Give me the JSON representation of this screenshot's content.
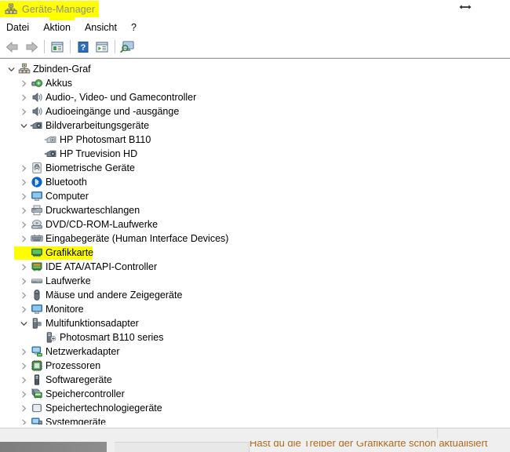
{
  "window": {
    "title": "Geräte-Manager",
    "title_icon": "device-manager-icon",
    "highlight_color": "#ffff00",
    "cursor": "horizontal-resize-cursor"
  },
  "menubar": {
    "items": [
      {
        "label": "Datei",
        "name": "menu-datei"
      },
      {
        "label": "Aktion",
        "name": "menu-aktion"
      },
      {
        "label": "Ansicht",
        "name": "menu-ansicht"
      },
      {
        "label": "?",
        "name": "menu-help"
      }
    ]
  },
  "toolbar": {
    "buttons": [
      {
        "icon": "back-arrow-icon",
        "name": "toolbar-back"
      },
      {
        "icon": "forward-arrow-icon",
        "name": "toolbar-forward"
      },
      {
        "icon": "properties-icon",
        "name": "toolbar-properties"
      },
      {
        "icon": "help-icon",
        "name": "toolbar-help"
      },
      {
        "icon": "update-driver-icon",
        "name": "toolbar-update-driver"
      },
      {
        "icon": "scan-hardware-icon",
        "name": "toolbar-scan-hardware"
      }
    ]
  },
  "tree": {
    "rows": [
      {
        "label": "Zbinden-Graf",
        "level": 0,
        "expander": "down",
        "icon": "computer-tree-icon",
        "highlight": false
      },
      {
        "label": "Akkus",
        "level": 1,
        "expander": "right",
        "icon": "battery-icon",
        "highlight": false
      },
      {
        "label": "Audio-, Video- und Gamecontroller",
        "level": 1,
        "expander": "right",
        "icon": "speaker-icon",
        "highlight": false
      },
      {
        "label": "Audioeingänge und -ausgänge",
        "level": 1,
        "expander": "right",
        "icon": "speaker-icon",
        "highlight": false
      },
      {
        "label": "Bildverarbeitungsgeräte",
        "level": 1,
        "expander": "down",
        "icon": "camera-icon",
        "highlight": false
      },
      {
        "label": "HP Photosmart B110",
        "level": 2,
        "expander": "none",
        "icon": "camera-device-icon",
        "highlight": false
      },
      {
        "label": "HP Truevision HD",
        "level": 2,
        "expander": "none",
        "icon": "camera-icon",
        "highlight": false
      },
      {
        "label": "Biometrische Geräte",
        "level": 1,
        "expander": "right",
        "icon": "fingerprint-icon",
        "highlight": false
      },
      {
        "label": "Bluetooth",
        "level": 1,
        "expander": "right",
        "icon": "bluetooth-icon",
        "highlight": false
      },
      {
        "label": "Computer",
        "level": 1,
        "expander": "right",
        "icon": "monitor-icon",
        "highlight": false
      },
      {
        "label": "Druckwarteschlangen",
        "level": 1,
        "expander": "right",
        "icon": "printer-icon",
        "highlight": false
      },
      {
        "label": "DVD/CD-ROM-Laufwerke",
        "level": 1,
        "expander": "right",
        "icon": "optical-drive-icon",
        "highlight": false
      },
      {
        "label": "Eingabegeräte (Human Interface Devices)",
        "level": 1,
        "expander": "right",
        "icon": "keyboard-icon",
        "highlight": false
      },
      {
        "label": "Grafikkarte",
        "level": 1,
        "expander": "right",
        "icon": "display-adapter-icon",
        "highlight": true
      },
      {
        "label": "IDE ATA/ATAPI-Controller",
        "level": 1,
        "expander": "right",
        "icon": "ide-controller-icon",
        "highlight": false
      },
      {
        "label": "Laufwerke",
        "level": 1,
        "expander": "right",
        "icon": "disk-drive-icon",
        "highlight": false
      },
      {
        "label": "Mäuse und andere Zeigegeräte",
        "level": 1,
        "expander": "right",
        "icon": "mouse-icon",
        "highlight": false
      },
      {
        "label": "Monitore",
        "level": 1,
        "expander": "right",
        "icon": "monitor-icon",
        "highlight": false
      },
      {
        "label": "Multifunktionsadapter",
        "level": 1,
        "expander": "down",
        "icon": "multifunction-icon",
        "highlight": false
      },
      {
        "label": "Photosmart B110 series",
        "level": 2,
        "expander": "none",
        "icon": "multifunction-device-icon",
        "highlight": false
      },
      {
        "label": "Netzwerkadapter",
        "level": 1,
        "expander": "right",
        "icon": "network-adapter-icon",
        "highlight": false
      },
      {
        "label": "Prozessoren",
        "level": 1,
        "expander": "right",
        "icon": "processor-icon",
        "highlight": false
      },
      {
        "label": "Softwaregeräte",
        "level": 1,
        "expander": "right",
        "icon": "software-device-icon",
        "highlight": false
      },
      {
        "label": "Speichercontroller",
        "level": 1,
        "expander": "right",
        "icon": "storage-controller-icon",
        "highlight": false
      },
      {
        "label": "Speichertechnologiegeräte",
        "level": 1,
        "expander": "right",
        "icon": "storage-tech-icon",
        "highlight": false
      },
      {
        "label": "Systemgeräte",
        "level": 1,
        "expander": "right",
        "icon": "system-device-icon",
        "highlight": false
      }
    ]
  },
  "bottom": {
    "overlay_text": "Hast du die Treiber der Grafikkarte schon aktualisiert"
  }
}
